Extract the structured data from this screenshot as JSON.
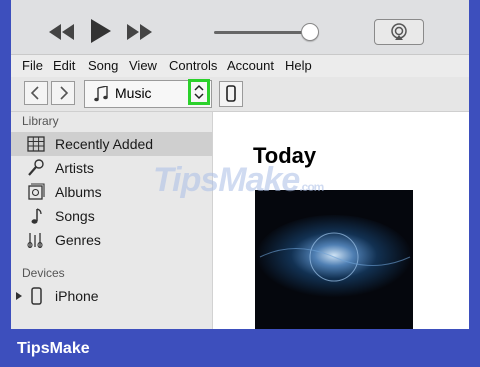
{
  "playback": {
    "prev_icon": "rewind-icon",
    "play_icon": "play-icon",
    "next_icon": "fast-forward-icon",
    "volume_level": 0.9,
    "airplay_icon": "airplay-icon"
  },
  "menubar": {
    "items": [
      "File",
      "Edit",
      "Song",
      "View",
      "Controls",
      "Account",
      "Help"
    ]
  },
  "toolbar": {
    "media_kind": "Music",
    "media_icon": "music-note-icon",
    "device_icon": "iphone-icon"
  },
  "sidebar": {
    "library_heading": "Library",
    "library_items": [
      {
        "label": "Recently Added",
        "icon": "grid-icon",
        "selected": true
      },
      {
        "label": "Artists",
        "icon": "microphone-icon"
      },
      {
        "label": "Albums",
        "icon": "album-icon"
      },
      {
        "label": "Songs",
        "icon": "music-note-icon"
      },
      {
        "label": "Genres",
        "icon": "guitar-icon"
      }
    ],
    "devices_heading": "Devices",
    "device_item": {
      "label": "iPhone",
      "icon": "iphone-icon"
    }
  },
  "main": {
    "title": "Today"
  },
  "watermark": {
    "text": "TipsMake",
    "tld": ".com"
  },
  "footer": {
    "brand": "TipsMake"
  },
  "colors": {
    "background": "#3d4fbd",
    "highlight": "#2bd12b",
    "selected_row": "#cfcfcf"
  }
}
